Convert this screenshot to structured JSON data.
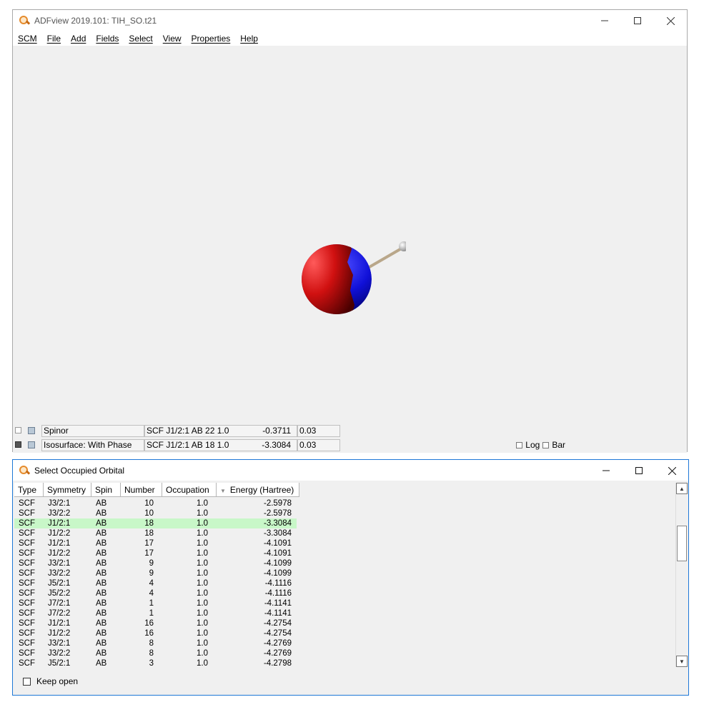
{
  "main_window": {
    "title": "ADFview 2019.101: TIH_SO.t21",
    "menu": [
      "SCM",
      "File",
      "Add",
      "Fields",
      "Select",
      "View",
      "Properties",
      "Help"
    ],
    "layers": [
      {
        "name": "Spinor",
        "description": "SCF J1/2:1 AB 22 1.0",
        "energy": "-0.3711",
        "value": "0.03",
        "checked": false
      },
      {
        "name": "Isosurface: With Phase",
        "description": "SCF J1/2:1 AB 18 1.0",
        "energy": "-3.3084",
        "value": "0.03",
        "checked": true
      }
    ],
    "log_label": "Log",
    "bar_label": "Bar"
  },
  "orbital_window": {
    "title": "Select Occupied Orbital",
    "columns": [
      "Type",
      "Symmetry",
      "Spin",
      "Number",
      "Occupation",
      "Energy (Hartree)"
    ],
    "rows": [
      [
        "SCF",
        "J3/2:1",
        "AB",
        "10",
        "1.0",
        "-2.5978"
      ],
      [
        "SCF",
        "J3/2:2",
        "AB",
        "10",
        "1.0",
        "-2.5978"
      ],
      [
        "SCF",
        "J1/2:1",
        "AB",
        "18",
        "1.0",
        "-3.3084"
      ],
      [
        "SCF",
        "J1/2:2",
        "AB",
        "18",
        "1.0",
        "-3.3084"
      ],
      [
        "SCF",
        "J1/2:1",
        "AB",
        "17",
        "1.0",
        "-4.1091"
      ],
      [
        "SCF",
        "J1/2:2",
        "AB",
        "17",
        "1.0",
        "-4.1091"
      ],
      [
        "SCF",
        "J3/2:1",
        "AB",
        "9",
        "1.0",
        "-4.1099"
      ],
      [
        "SCF",
        "J3/2:2",
        "AB",
        "9",
        "1.0",
        "-4.1099"
      ],
      [
        "SCF",
        "J5/2:1",
        "AB",
        "4",
        "1.0",
        "-4.1116"
      ],
      [
        "SCF",
        "J5/2:2",
        "AB",
        "4",
        "1.0",
        "-4.1116"
      ],
      [
        "SCF",
        "J7/2:1",
        "AB",
        "1",
        "1.0",
        "-4.1141"
      ],
      [
        "SCF",
        "J7/2:2",
        "AB",
        "1",
        "1.0",
        "-4.1141"
      ],
      [
        "SCF",
        "J1/2:1",
        "AB",
        "16",
        "1.0",
        "-4.2754"
      ],
      [
        "SCF",
        "J1/2:2",
        "AB",
        "16",
        "1.0",
        "-4.2754"
      ],
      [
        "SCF",
        "J3/2:1",
        "AB",
        "8",
        "1.0",
        "-4.2769"
      ],
      [
        "SCF",
        "J3/2:2",
        "AB",
        "8",
        "1.0",
        "-4.2769"
      ],
      [
        "SCF",
        "J5/2:1",
        "AB",
        "3",
        "1.0",
        "-4.2798"
      ]
    ],
    "selected_row": 2,
    "keep_open_label": "Keep open"
  },
  "colors": {
    "selected_row": "#c8f7c8",
    "phase_positive": "#d01010",
    "phase_negative": "#1010d8",
    "active_border": "#1e78d7"
  },
  "icons": [
    "app-icon",
    "minimize-icon",
    "maximize-icon",
    "close-icon",
    "sort-arrow-icon",
    "scroll-up-icon",
    "scroll-down-icon"
  ]
}
